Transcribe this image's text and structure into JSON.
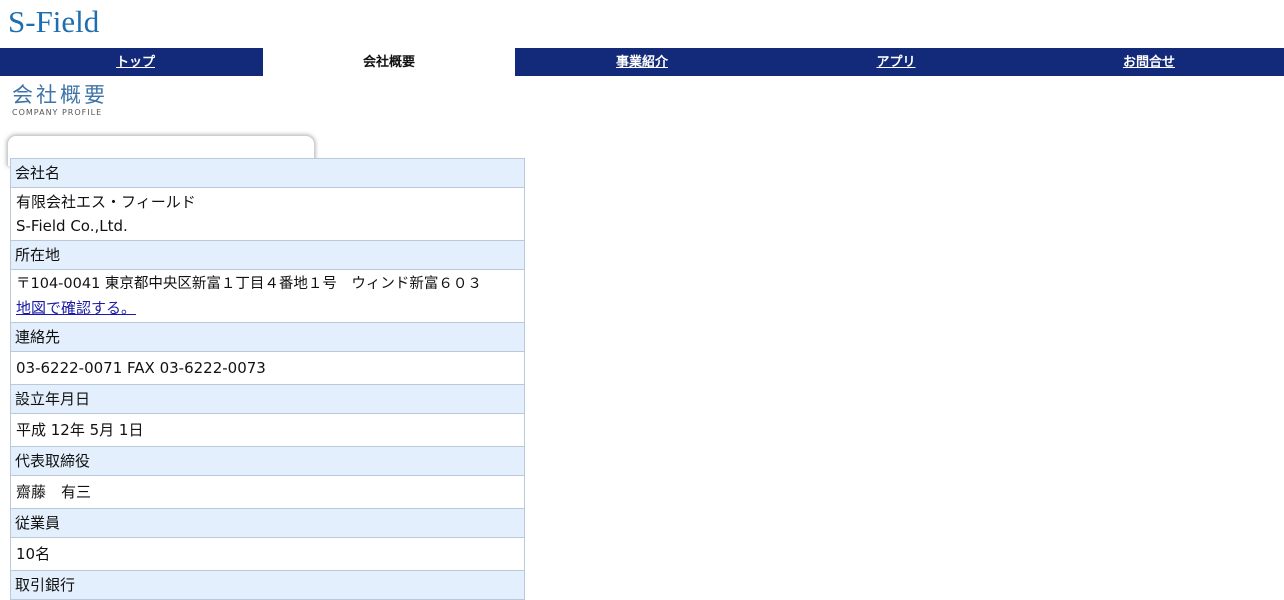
{
  "site": {
    "logo": "S-Field"
  },
  "nav": {
    "items": [
      {
        "label": "トップ",
        "active": false
      },
      {
        "label": "会社概要",
        "active": true
      },
      {
        "label": "事業紹介",
        "active": false
      },
      {
        "label": "アプリ",
        "active": false
      },
      {
        "label": "お問合せ",
        "active": false
      }
    ]
  },
  "page": {
    "title": "会社概要",
    "subtitle": "COMPANY PROFILE"
  },
  "profile": {
    "company_name": {
      "label": "会社名",
      "line1": "有限会社エス・フィールド",
      "line2": "S-Field Co.,Ltd."
    },
    "address": {
      "label": "所在地",
      "value": "〒104-0041 東京都中央区新富１丁目４番地１号　ウィンド新富６０３",
      "map_link": "地図で確認する。"
    },
    "contact": {
      "label": "連絡先",
      "value": "03-6222-0071 FAX 03-6222-0073"
    },
    "founded": {
      "label": "設立年月日",
      "value": "平成 12年 5月 1日"
    },
    "ceo": {
      "label": "代表取締役",
      "value": "齋藤　有三"
    },
    "employees": {
      "label": "従業員",
      "value": "10名"
    },
    "bank": {
      "label": "取引銀行"
    }
  }
}
